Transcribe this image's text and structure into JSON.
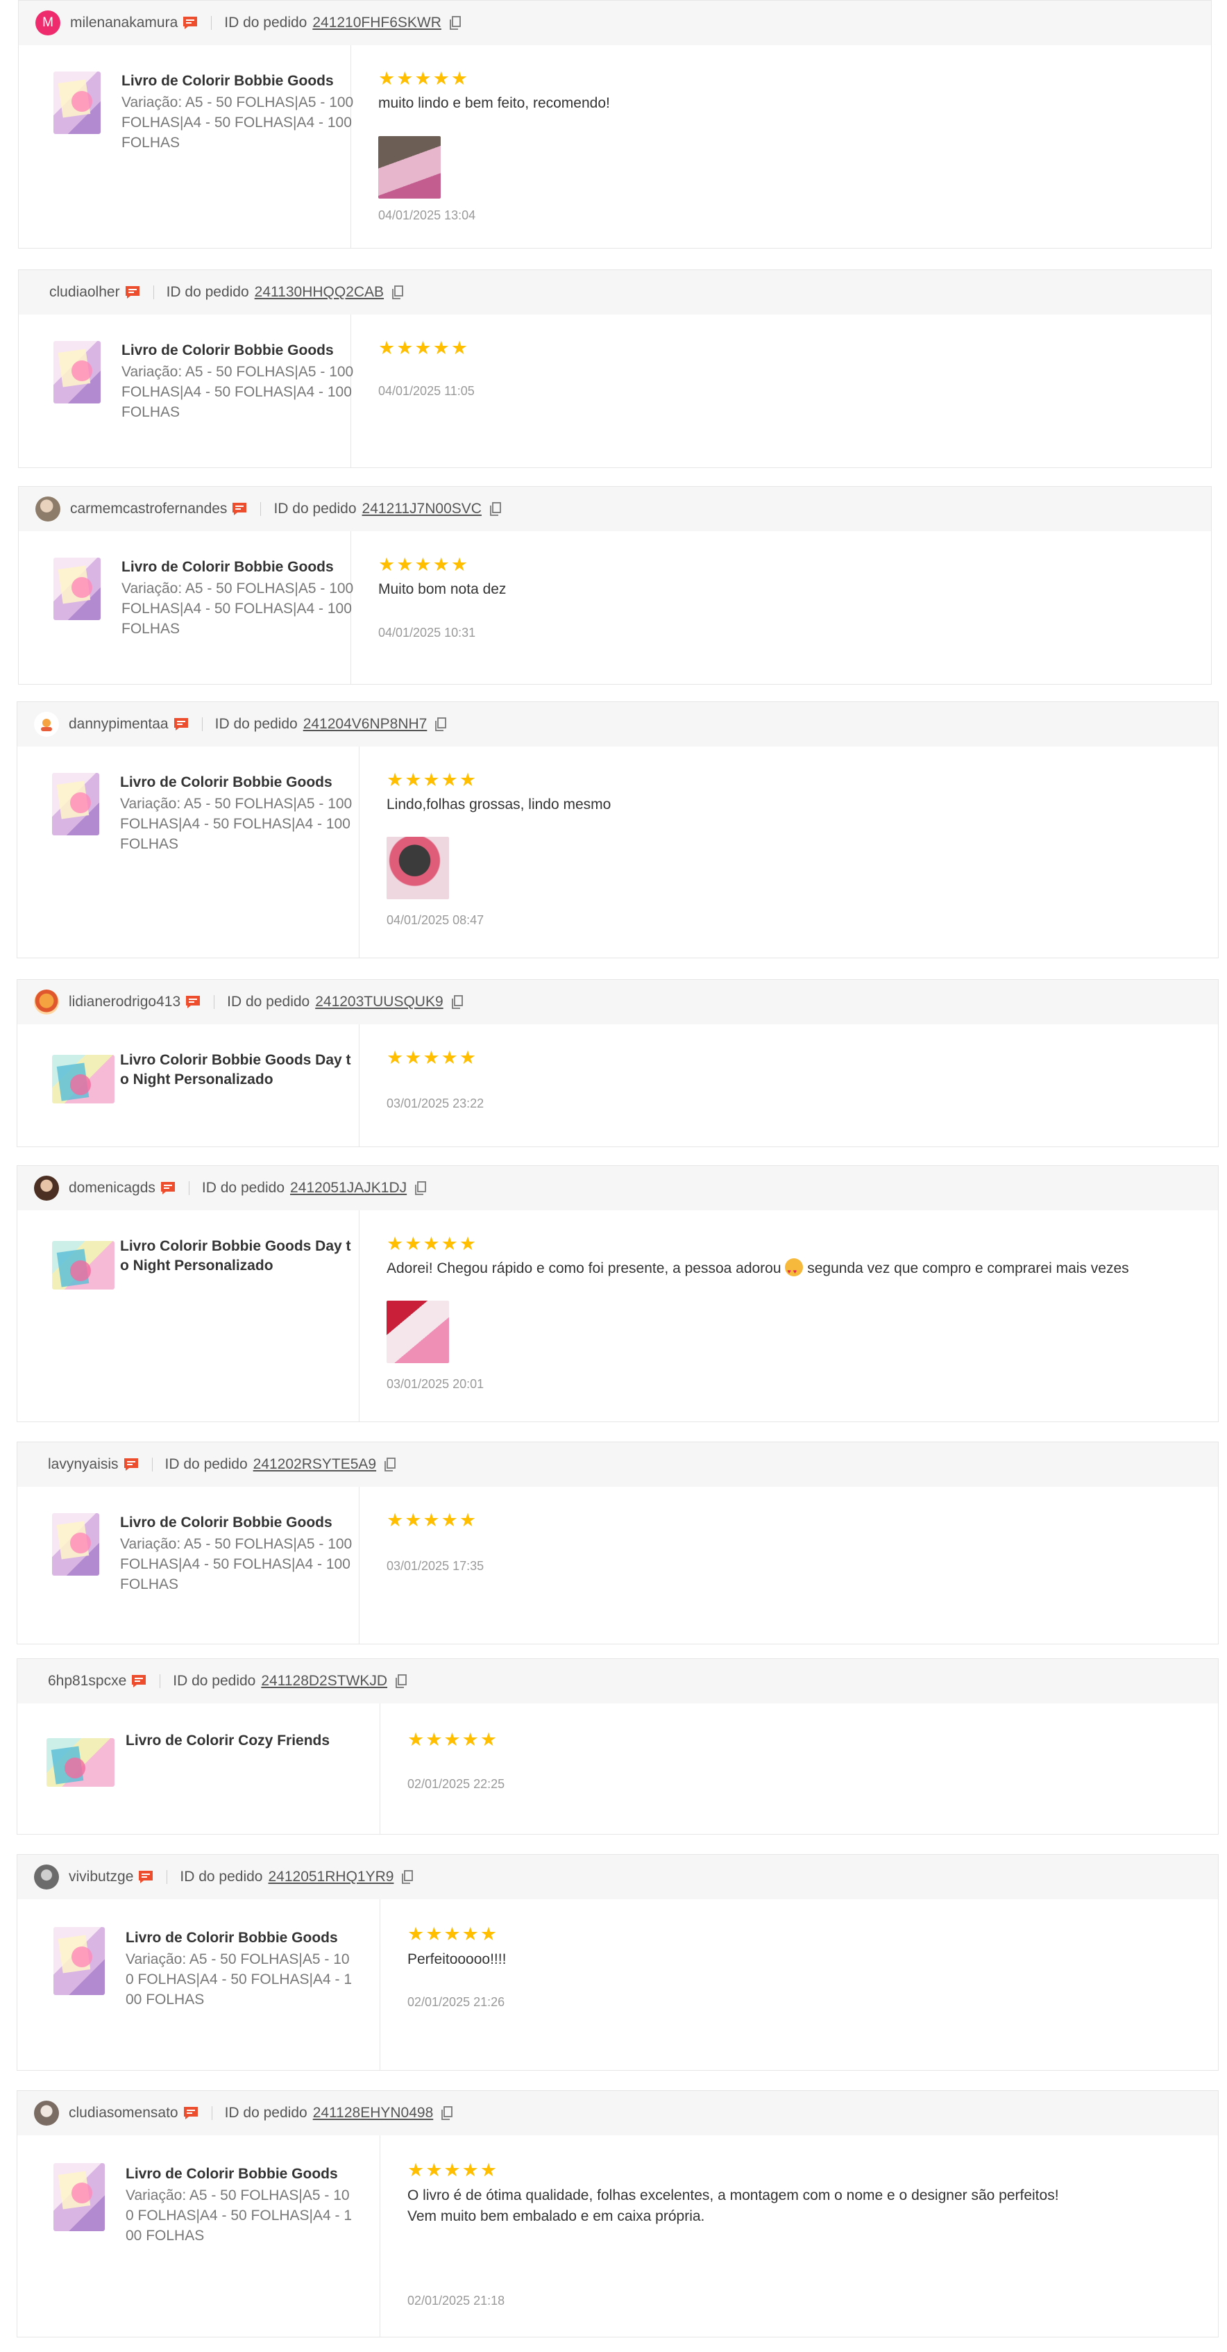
{
  "labels": {
    "order_id": "ID do pedido"
  },
  "colors": {
    "star": "#ffbf00",
    "chat_icon": "#ee4d2d",
    "avatar_letter_bg": "#ee2b6c"
  },
  "reviews": [
    {
      "user": "milenanakamura",
      "avatar_letter": "M",
      "order_id": "241210FHF6SKWR",
      "product": "Livro de Colorir Bobbie Goods",
      "variation": "Variação: A5 - 50 FOLHAS|A5 - 100 FOLHAS|A4 - 50 FOLHAS|A4 - 100 FOLHAS",
      "rating": 5,
      "comment": "muito lindo e bem feito, recomendo!",
      "date": "04/01/2025 13:04"
    },
    {
      "user": "cludiaolher",
      "order_id": "241130HHQQ2CAB",
      "product": "Livro de Colorir Bobbie Goods",
      "variation": "Variação: A5 - 50 FOLHAS|A5 - 100 FOLHAS|A4 - 50 FOLHAS|A4 - 100 FOLHAS",
      "rating": 5,
      "comment": "",
      "date": "04/01/2025 11:05"
    },
    {
      "user": "carmemcastrofernandes",
      "order_id": "241211J7N00SVC",
      "product": "Livro de Colorir Bobbie Goods",
      "variation": "Variação: A5 - 50 FOLHAS|A5 - 100 FOLHAS|A4 - 50 FOLHAS|A4 - 100 FOLHAS",
      "rating": 5,
      "comment": "Muito bom nota dez",
      "date": "04/01/2025 10:31"
    },
    {
      "user": "dannypimentaa",
      "order_id": "241204V6NP8NH7",
      "product": "Livro de Colorir Bobbie Goods",
      "variation": "Variação: A5 - 50 FOLHAS|A5 - 100 FOLHAS|A4 - 50 FOLHAS|A4 - 100 FOLHAS",
      "rating": 5,
      "comment": "Lindo,folhas grossas, lindo mesmo",
      "date": "04/01/2025 08:47"
    },
    {
      "user": "lidianerodrigo413",
      "order_id": "241203TUUSQUK9",
      "product": "Livro Colorir Bobbie Goods Day to Night Personalizado",
      "variation": "",
      "rating": 5,
      "comment": "",
      "date": "03/01/2025 23:22"
    },
    {
      "user": "domenicagds",
      "order_id": "2412051JAJK1DJ",
      "product": "Livro Colorir Bobbie Goods Day to Night Personalizado",
      "variation": "",
      "rating": 5,
      "comment_before": "Adorei! Chegou rápido e como foi presente, a pessoa adorou",
      "comment_after": "segunda vez que compro e comprarei mais vezes",
      "date": "03/01/2025 20:01"
    },
    {
      "user": "lavynyaisis",
      "order_id": "241202RSYTE5A9",
      "product": "Livro de Colorir Bobbie Goods",
      "variation": "Variação: A5 - 50 FOLHAS|A5 - 100 FOLHAS|A4 - 50 FOLHAS|A4 - 100 FOLHAS",
      "rating": 5,
      "comment": "",
      "date": "03/01/2025 17:35"
    },
    {
      "user": "6hp81spcxe",
      "order_id": "241128D2STWKJD",
      "product": "Livro de Colorir Cozy Friends",
      "variation": "",
      "rating": 5,
      "comment": "",
      "date": "02/01/2025 22:25"
    },
    {
      "user": "vivibutzge",
      "order_id": "2412051RHQ1YR9",
      "product": "Livro de Colorir Bobbie Goods",
      "variation": "Variação: A5 - 50 FOLHAS|A5 - 100 FOLHAS|A4 - 50 FOLHAS|A4 - 100 FOLHAS",
      "rating": 5,
      "comment": "Perfeitooooo!!!!",
      "date": "02/01/2025 21:26"
    },
    {
      "user": "cludiasomensato",
      "order_id": "241128EHYN0498",
      "product": "Livro de Colorir Bobbie Goods",
      "variation": "Variação: A5 - 50 FOLHAS|A5 - 100 FOLHAS|A4 - 50 FOLHAS|A4 - 100 FOLHAS",
      "rating": 5,
      "comment_line1": "O livro é de ótima qualidade, folhas excelentes, a montagem com o nome e o designer são perfeitos!",
      "comment_line2": "Vem muito bem embalado e em caixa própria.",
      "date": "02/01/2025 21:18"
    }
  ]
}
